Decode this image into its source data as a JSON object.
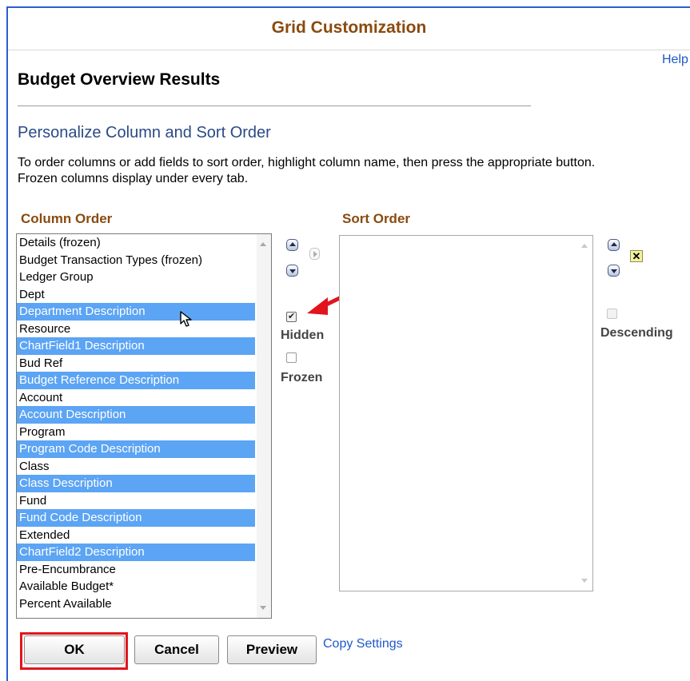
{
  "title": "Grid Customization",
  "help_label": "Help",
  "page_heading": "Budget Overview Results",
  "section_title": "Personalize Column and Sort Order",
  "instructions": [
    "To order columns or add fields to sort order, highlight column name, then press the appropriate button.",
    "Frozen columns display under every tab."
  ],
  "column_order": {
    "label": "Column Order",
    "items": [
      {
        "label": "Details (frozen)",
        "selected": false
      },
      {
        "label": "Budget Transaction Types (frozen)",
        "selected": false
      },
      {
        "label": "Ledger Group",
        "selected": false
      },
      {
        "label": "Dept",
        "selected": false
      },
      {
        "label": "Department Description",
        "selected": true
      },
      {
        "label": "Resource",
        "selected": false
      },
      {
        "label": "ChartField1 Description",
        "selected": true
      },
      {
        "label": "Bud Ref",
        "selected": false
      },
      {
        "label": "Budget Reference Description",
        "selected": true
      },
      {
        "label": "Account",
        "selected": false
      },
      {
        "label": "Account Description",
        "selected": true
      },
      {
        "label": "Program",
        "selected": false
      },
      {
        "label": "Program Code Description",
        "selected": true
      },
      {
        "label": "Class",
        "selected": false
      },
      {
        "label": "Class Description",
        "selected": true
      },
      {
        "label": "Fund",
        "selected": false
      },
      {
        "label": "Fund Code Description",
        "selected": true
      },
      {
        "label": "Extended",
        "selected": false
      },
      {
        "label": "ChartField2 Description",
        "selected": true
      },
      {
        "label": "Pre-Encumbrance",
        "selected": false
      },
      {
        "label": "Available Budget*",
        "selected": false
      },
      {
        "label": "Percent Available",
        "selected": false
      }
    ]
  },
  "sort_order": {
    "label": "Sort Order",
    "items": []
  },
  "options": {
    "hidden_label": "Hidden",
    "hidden_checked": true,
    "frozen_label": "Frozen",
    "frozen_checked": false,
    "descending_label": "Descending",
    "descending_checked": false
  },
  "buttons": {
    "ok": "OK",
    "cancel": "Cancel",
    "preview": "Preview",
    "copy_settings": "Copy Settings"
  },
  "colors": {
    "title": "#8a4a0f",
    "link": "#1f58c9",
    "selection": "#5ca4f4",
    "highlight_annotation": "#e2141e"
  },
  "icons": {
    "move_up": "arrow-up-icon",
    "move_down": "arrow-down-icon",
    "add_to_sort": "arrow-right-icon",
    "remove_from_sort": "x-icon",
    "cursor": "mouse-pointer-icon",
    "annotation": "red-arrow-icon"
  }
}
